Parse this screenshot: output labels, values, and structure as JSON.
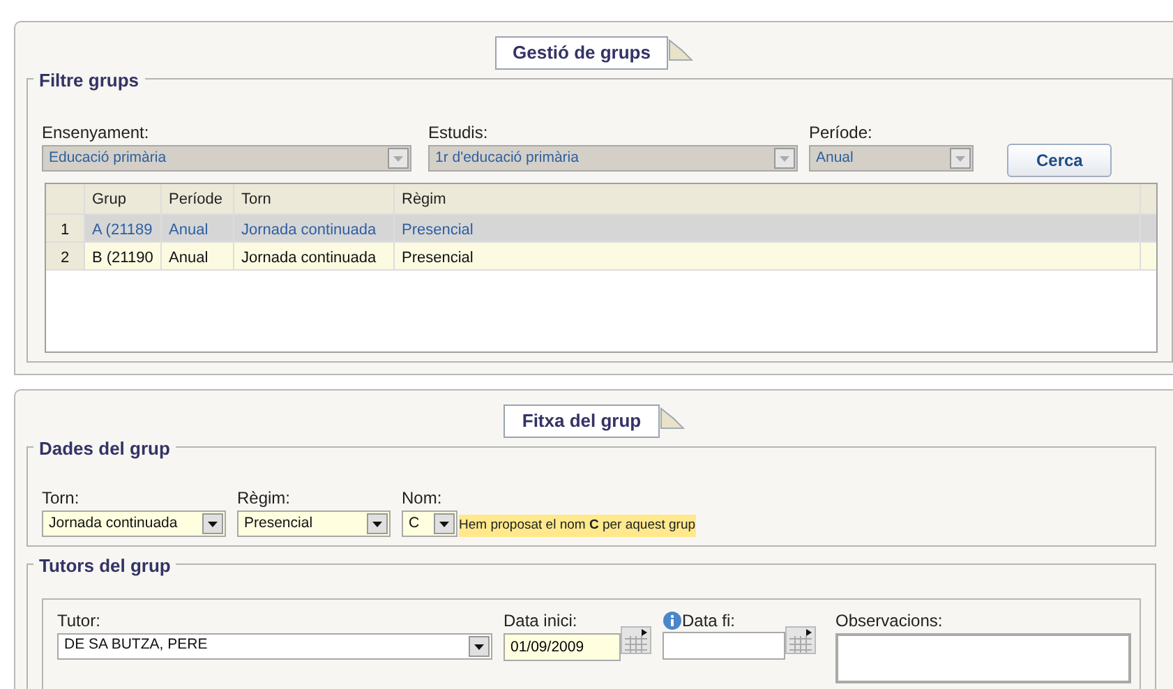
{
  "main_panel": {
    "title": "Gestió de grups"
  },
  "filter": {
    "legend": "Filtre grups",
    "fields": [
      {
        "label": "Ensenyament:",
        "value": "Educació primària",
        "disabled": true
      },
      {
        "label": "Estudis:",
        "value": "1r d'educació primària",
        "disabled": true
      },
      {
        "label": "Període:",
        "value": "Anual",
        "disabled": true
      }
    ],
    "search_button": "Cerca"
  },
  "table": {
    "columns": [
      "Grup",
      "Període",
      "Torn",
      "Règim"
    ],
    "rows": [
      {
        "number": "1",
        "cells": [
          "A (21189",
          "Anual",
          "Jornada continuada",
          "Presencial"
        ],
        "selected": true
      },
      {
        "number": "2",
        "cells": [
          "B (21190",
          "Anual",
          "Jornada continuada",
          "Presencial"
        ],
        "selected": false
      }
    ]
  },
  "detail_panel": {
    "title": "Fitxa del grup"
  },
  "group_data": {
    "legend": "Dades del grup",
    "fields": [
      {
        "label": "Torn:",
        "value": "Jornada continuada"
      },
      {
        "label": "Règim:",
        "value": "Presencial"
      },
      {
        "label": "Nom:",
        "value": "C"
      }
    ],
    "hint": "Hem proposat el nom **C** per aquest grup"
  },
  "tutors": {
    "legend": "Tutors del grup",
    "tutor": {
      "label": "Tutor:",
      "value": "DE SA BUTZA, PERE"
    },
    "start_date": {
      "label": "Data inici:",
      "value": "01/09/2009"
    },
    "end_date": {
      "label": "Data fi:"
    },
    "observations": {
      "label": "Observacions:"
    }
  }
}
